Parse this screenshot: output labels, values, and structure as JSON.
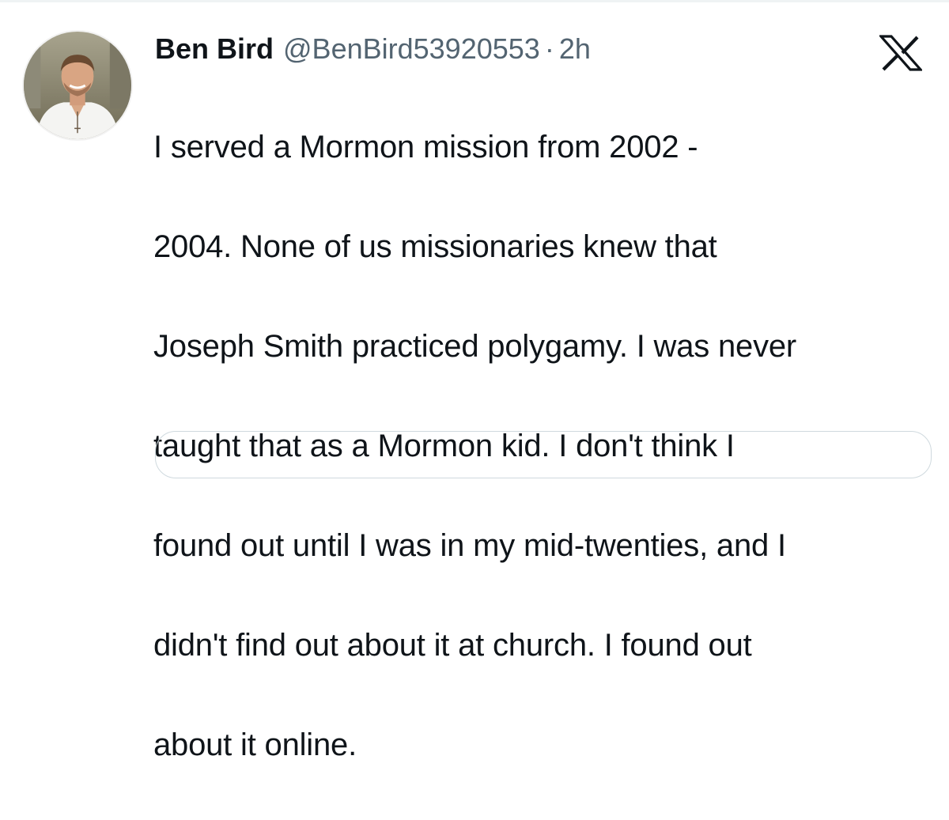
{
  "tweet": {
    "author": {
      "display_name": "Ben Bird",
      "handle": "@BenBird53920553",
      "avatar_icon": "profile-photo"
    },
    "separator": "·",
    "timestamp": "2h",
    "platform_icon": "x-logo-icon",
    "text_lines": [
      "I served a Mormon mission from 2002 -",
      "2004. None of us missionaries knew that",
      "Joseph Smith practiced polygamy. I was never",
      "taught that as a Mormon kid. I don't think I",
      "found out until I was in my mid-twenties, and I",
      "didn't find out about it at church. I found out",
      "about it online."
    ]
  },
  "colors": {
    "text_primary": "#0f1419",
    "text_secondary": "#536471",
    "border": "#cfd9de"
  }
}
